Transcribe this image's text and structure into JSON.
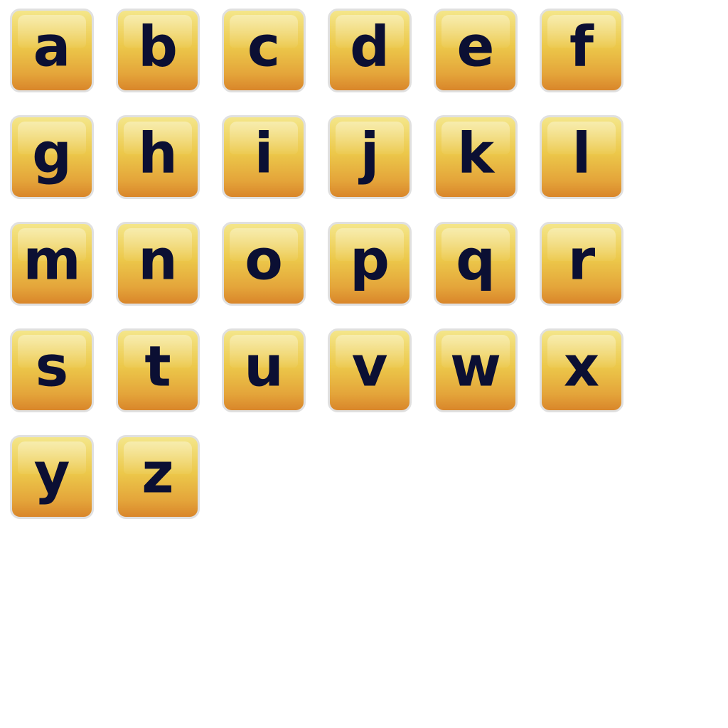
{
  "tiles": [
    {
      "letter": "a"
    },
    {
      "letter": "b"
    },
    {
      "letter": "c"
    },
    {
      "letter": "d"
    },
    {
      "letter": "e"
    },
    {
      "letter": "f"
    },
    {
      "letter": "g"
    },
    {
      "letter": "h"
    },
    {
      "letter": "i"
    },
    {
      "letter": "j"
    },
    {
      "letter": "k"
    },
    {
      "letter": "l"
    },
    {
      "letter": "m"
    },
    {
      "letter": "n"
    },
    {
      "letter": "o"
    },
    {
      "letter": "p"
    },
    {
      "letter": "q"
    },
    {
      "letter": "r"
    },
    {
      "letter": "s"
    },
    {
      "letter": "t"
    },
    {
      "letter": "u"
    },
    {
      "letter": "v"
    },
    {
      "letter": "w"
    },
    {
      "letter": "x"
    },
    {
      "letter": "y"
    },
    {
      "letter": "z"
    }
  ],
  "colors": {
    "tile_top": "#f4e68a",
    "tile_bottom": "#d9862a",
    "tile_border": "#e0e0e0",
    "letter": "#0b0f33"
  }
}
